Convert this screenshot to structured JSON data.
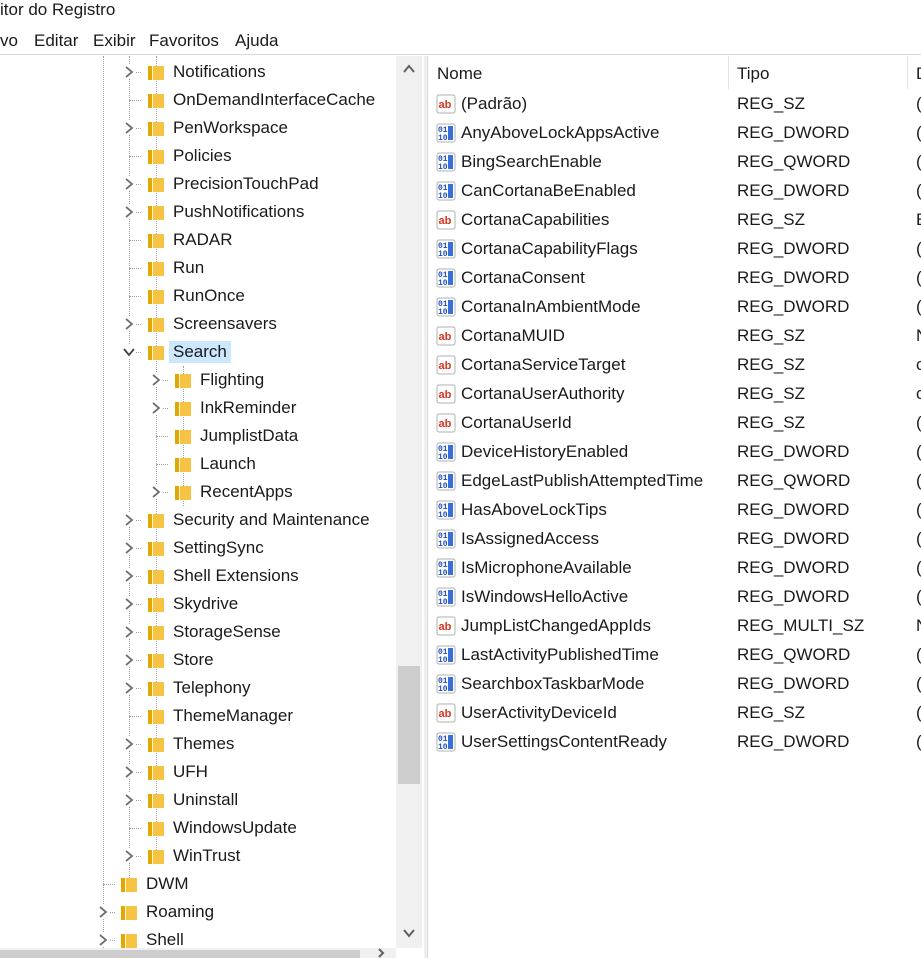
{
  "window": {
    "title": "itor do Registro"
  },
  "menu": {
    "items": [
      "vo",
      "Editar",
      "Exibir",
      "Favoritos",
      "Ajuda"
    ]
  },
  "tree": {
    "items": [
      {
        "label": "Notifications",
        "expander": "collapsed"
      },
      {
        "label": "OnDemandInterfaceCache",
        "expander": "none"
      },
      {
        "label": "PenWorkspace",
        "expander": "collapsed"
      },
      {
        "label": "Policies",
        "expander": "none"
      },
      {
        "label": "PrecisionTouchPad",
        "expander": "collapsed"
      },
      {
        "label": "PushNotifications",
        "expander": "collapsed"
      },
      {
        "label": "RADAR",
        "expander": "none"
      },
      {
        "label": "Run",
        "expander": "none"
      },
      {
        "label": "RunOnce",
        "expander": "none"
      },
      {
        "label": "Screensavers",
        "expander": "collapsed"
      },
      {
        "label": "Search",
        "expander": "expanded",
        "selected": true
      },
      {
        "label": "Flighting",
        "expander": "collapsed"
      },
      {
        "label": "InkReminder",
        "expander": "collapsed"
      },
      {
        "label": "JumplistData",
        "expander": "none"
      },
      {
        "label": "Launch",
        "expander": "none"
      },
      {
        "label": "RecentApps",
        "expander": "collapsed"
      },
      {
        "label": "Security and Maintenance",
        "expander": "collapsed"
      },
      {
        "label": "SettingSync",
        "expander": "collapsed"
      },
      {
        "label": "Shell Extensions",
        "expander": "collapsed"
      },
      {
        "label": "Skydrive",
        "expander": "collapsed"
      },
      {
        "label": "StorageSense",
        "expander": "collapsed"
      },
      {
        "label": "Store",
        "expander": "collapsed"
      },
      {
        "label": "Telephony",
        "expander": "collapsed"
      },
      {
        "label": "ThemeManager",
        "expander": "none"
      },
      {
        "label": "Themes",
        "expander": "collapsed"
      },
      {
        "label": "UFH",
        "expander": "collapsed"
      },
      {
        "label": "Uninstall",
        "expander": "collapsed"
      },
      {
        "label": "WindowsUpdate",
        "expander": "none"
      },
      {
        "label": "WinTrust",
        "expander": "collapsed"
      },
      {
        "label": "DWM",
        "expander": "none"
      },
      {
        "label": "Roaming",
        "expander": "collapsed"
      },
      {
        "label": "Shell",
        "expander": "collapsed"
      }
    ]
  },
  "list": {
    "columns": [
      "Nome",
      "Tipo",
      "D"
    ],
    "rows": [
      {
        "name": "(Padrão)",
        "type": "REG_SZ",
        "data": "(",
        "icon": "string-value-icon"
      },
      {
        "name": "AnyAboveLockAppsActive",
        "type": "REG_DWORD",
        "data": "(",
        "icon": "binary-value-icon"
      },
      {
        "name": "BingSearchEnable",
        "type": "REG_QWORD",
        "data": "(",
        "icon": "binary-value-icon"
      },
      {
        "name": "CanCortanaBeEnabled",
        "type": "REG_DWORD",
        "data": "(",
        "icon": "binary-value-icon"
      },
      {
        "name": "CortanaCapabilities",
        "type": "REG_SZ",
        "data": "E",
        "icon": "string-value-icon"
      },
      {
        "name": "CortanaCapabilityFlags",
        "type": "REG_DWORD",
        "data": "(",
        "icon": "binary-value-icon"
      },
      {
        "name": "CortanaConsent",
        "type": "REG_DWORD",
        "data": "(",
        "icon": "binary-value-icon"
      },
      {
        "name": "CortanaInAmbientMode",
        "type": "REG_DWORD",
        "data": "(",
        "icon": "binary-value-icon"
      },
      {
        "name": "CortanaMUID",
        "type": "REG_SZ",
        "data": "N",
        "icon": "string-value-icon"
      },
      {
        "name": "CortanaServiceTarget",
        "type": "REG_SZ",
        "data": "c",
        "icon": "string-value-icon"
      },
      {
        "name": "CortanaUserAuthority",
        "type": "REG_SZ",
        "data": "c",
        "icon": "string-value-icon"
      },
      {
        "name": "CortanaUserId",
        "type": "REG_SZ",
        "data": "(",
        "icon": "string-value-icon"
      },
      {
        "name": "DeviceHistoryEnabled",
        "type": "REG_DWORD",
        "data": "(",
        "icon": "binary-value-icon"
      },
      {
        "name": "EdgeLastPublishAttemptedTime",
        "type": "REG_QWORD",
        "data": "(",
        "icon": "binary-value-icon"
      },
      {
        "name": "HasAboveLockTips",
        "type": "REG_DWORD",
        "data": "(",
        "icon": "binary-value-icon"
      },
      {
        "name": "IsAssignedAccess",
        "type": "REG_DWORD",
        "data": "(",
        "icon": "binary-value-icon"
      },
      {
        "name": "IsMicrophoneAvailable",
        "type": "REG_DWORD",
        "data": "(",
        "icon": "binary-value-icon"
      },
      {
        "name": "IsWindowsHelloActive",
        "type": "REG_DWORD",
        "data": "(",
        "icon": "binary-value-icon"
      },
      {
        "name": "JumpListChangedAppIds",
        "type": "REG_MULTI_SZ",
        "data": "N",
        "icon": "string-value-icon"
      },
      {
        "name": "LastActivityPublishedTime",
        "type": "REG_QWORD",
        "data": "(",
        "icon": "binary-value-icon"
      },
      {
        "name": "SearchboxTaskbarMode",
        "type": "REG_DWORD",
        "data": "(",
        "icon": "binary-value-icon"
      },
      {
        "name": "UserActivityDeviceId",
        "type": "REG_SZ",
        "data": "(",
        "icon": "string-value-icon"
      },
      {
        "name": "UserSettingsContentReady",
        "type": "REG_DWORD",
        "data": "(",
        "icon": "binary-value-icon"
      }
    ]
  },
  "colors": {
    "selection": "#cce8ff",
    "folder": "#f6c344",
    "scrollbar": "#cdcdcd"
  }
}
